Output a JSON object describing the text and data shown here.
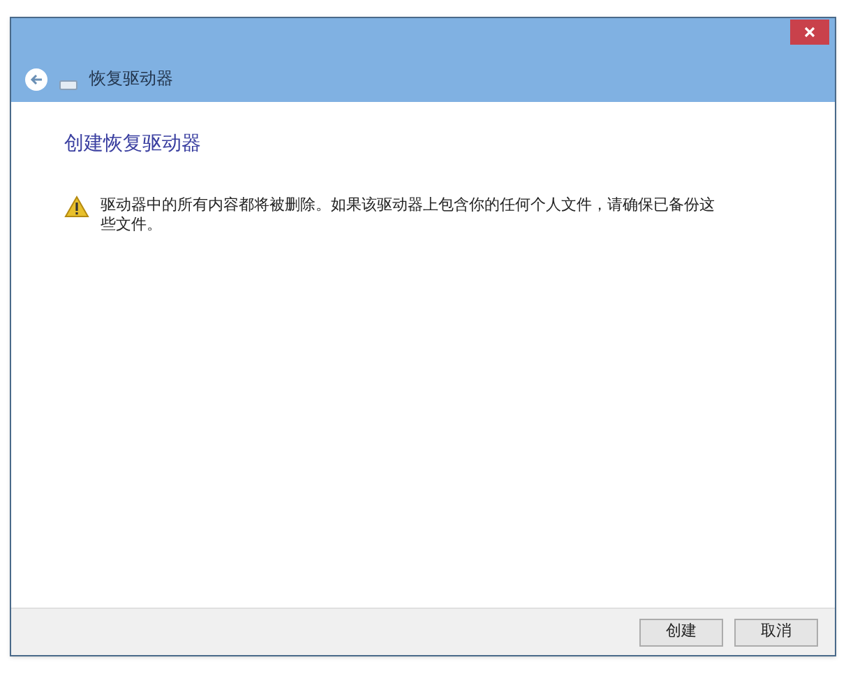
{
  "window": {
    "title": "恢复驱动器"
  },
  "heading": "创建恢复驱动器",
  "warning": "驱动器中的所有内容都将被删除。如果该驱动器上包含你的任何个人文件，请确保已备份这些文件。",
  "buttons": [
    "创建",
    "取消"
  ]
}
